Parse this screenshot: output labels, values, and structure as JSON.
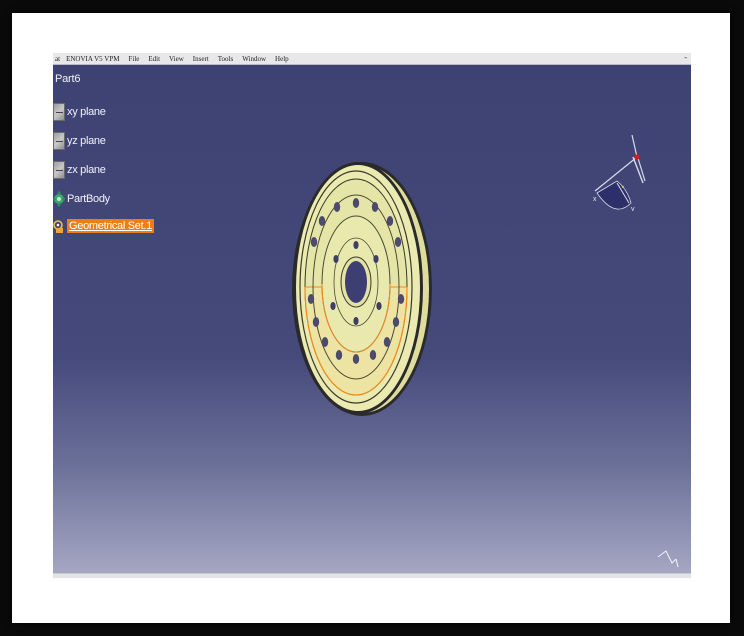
{
  "menubar": {
    "app_logo_text": "at",
    "product": "ENOVIA V5 VPM",
    "items": [
      "File",
      "Edit",
      "View",
      "Insert",
      "Tools",
      "Window",
      "Help"
    ],
    "minimize_glyph": "-"
  },
  "tree": {
    "root_label": "Part6",
    "nodes": [
      {
        "label": "xy plane",
        "icon": "plane-icon"
      },
      {
        "label": "yz plane",
        "icon": "plane-icon"
      },
      {
        "label": "zx plane",
        "icon": "plane-icon"
      },
      {
        "label": "PartBody",
        "icon": "gear-icon"
      },
      {
        "label": "Geometrical Set.1",
        "icon": "geometrical-set-icon",
        "selected": true
      }
    ]
  },
  "compass": {
    "x_label": "x",
    "y_label": "y"
  },
  "colors": {
    "viewport_top": "#3e4272",
    "viewport_bottom": "#a7a9c4",
    "selection": "#f07d13",
    "part": "#ecebb1",
    "part_highlight": "#f28a1e"
  }
}
